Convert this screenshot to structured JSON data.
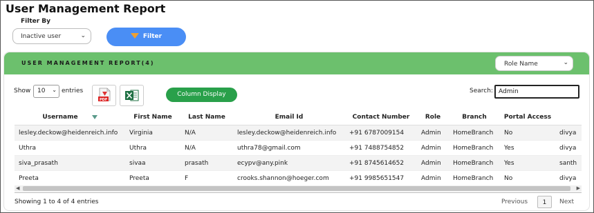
{
  "page": {
    "title": "User Management Report"
  },
  "filters": {
    "filter_by_label": "Filter By",
    "status_select_value": "Inactive user",
    "filter_button_label": "Filter"
  },
  "report": {
    "title": "USER MANAGEMENT REPORT(4)",
    "role_select_value": "Role Name",
    "header_color": "#6cc06d",
    "show_label": "Show",
    "show_value": "10",
    "entries_label": "entries",
    "pdf_label": "PDF",
    "column_display_label": "Column Display",
    "search_label": "Search:",
    "search_value": "Admin",
    "columns": [
      "Username",
      "First Name",
      "Last Name",
      "Email Id",
      "Contact Number",
      "Role",
      "Branch",
      "Portal Access",
      ""
    ],
    "rows": [
      [
        "lesley.deckow@heidenreich.info",
        "Virginia",
        "N/A",
        "lesley.deckow@heidenreich.info",
        "+91 6787009154",
        "Admin",
        "HomeBranch",
        "No",
        "divya"
      ],
      [
        "Uthra",
        "Uthra",
        "N/A",
        "uthra78@gmail.com",
        "+91 7488754852",
        "Admin",
        "HomeBranch",
        "Yes",
        "divya"
      ],
      [
        "siva_prasath",
        "sivaa",
        "prasath",
        "ecypv@any.pink",
        "+91 8745614652",
        "Admin",
        "HomeBranch",
        "Yes",
        "santh"
      ],
      [
        "Preeta",
        "Preeta",
        "F",
        "crooks.shannon@hoeger.com",
        "+91 9985651547",
        "Admin",
        "HomeBranch",
        "No",
        "divya"
      ]
    ],
    "showing_text": "Showing 1 to 4 of 4 entries",
    "previous_label": "Previous",
    "current_page": "1",
    "next_label": "Next"
  }
}
